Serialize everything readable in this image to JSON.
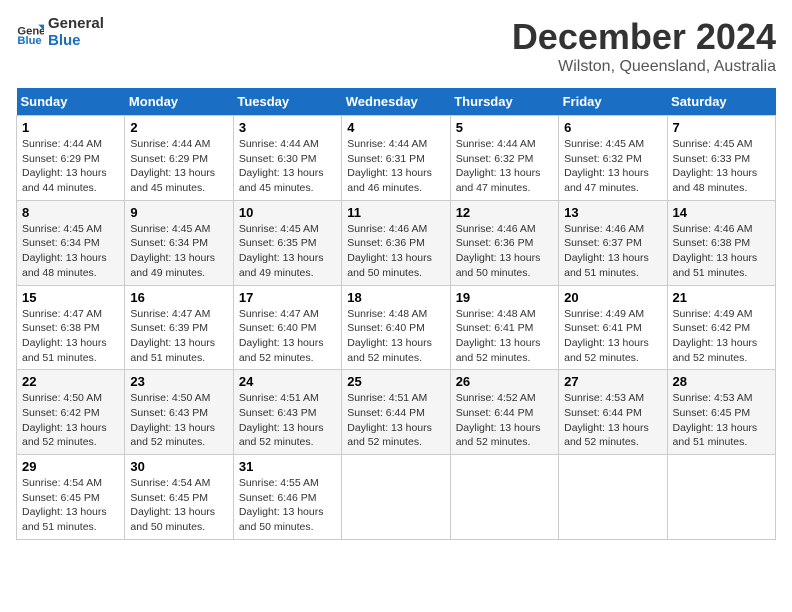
{
  "header": {
    "logo_line1": "General",
    "logo_line2": "Blue",
    "title": "December 2024",
    "subtitle": "Wilston, Queensland, Australia"
  },
  "weekdays": [
    "Sunday",
    "Monday",
    "Tuesday",
    "Wednesday",
    "Thursday",
    "Friday",
    "Saturday"
  ],
  "weeks": [
    [
      {
        "day": 1,
        "sunrise": "4:44 AM",
        "sunset": "6:29 PM",
        "daylight": "13 hours and 44 minutes."
      },
      {
        "day": 2,
        "sunrise": "4:44 AM",
        "sunset": "6:29 PM",
        "daylight": "13 hours and 45 minutes."
      },
      {
        "day": 3,
        "sunrise": "4:44 AM",
        "sunset": "6:30 PM",
        "daylight": "13 hours and 45 minutes."
      },
      {
        "day": 4,
        "sunrise": "4:44 AM",
        "sunset": "6:31 PM",
        "daylight": "13 hours and 46 minutes."
      },
      {
        "day": 5,
        "sunrise": "4:44 AM",
        "sunset": "6:32 PM",
        "daylight": "13 hours and 47 minutes."
      },
      {
        "day": 6,
        "sunrise": "4:45 AM",
        "sunset": "6:32 PM",
        "daylight": "13 hours and 47 minutes."
      },
      {
        "day": 7,
        "sunrise": "4:45 AM",
        "sunset": "6:33 PM",
        "daylight": "13 hours and 48 minutes."
      }
    ],
    [
      {
        "day": 8,
        "sunrise": "4:45 AM",
        "sunset": "6:34 PM",
        "daylight": "13 hours and 48 minutes."
      },
      {
        "day": 9,
        "sunrise": "4:45 AM",
        "sunset": "6:34 PM",
        "daylight": "13 hours and 49 minutes."
      },
      {
        "day": 10,
        "sunrise": "4:45 AM",
        "sunset": "6:35 PM",
        "daylight": "13 hours and 49 minutes."
      },
      {
        "day": 11,
        "sunrise": "4:46 AM",
        "sunset": "6:36 PM",
        "daylight": "13 hours and 50 minutes."
      },
      {
        "day": 12,
        "sunrise": "4:46 AM",
        "sunset": "6:36 PM",
        "daylight": "13 hours and 50 minutes."
      },
      {
        "day": 13,
        "sunrise": "4:46 AM",
        "sunset": "6:37 PM",
        "daylight": "13 hours and 51 minutes."
      },
      {
        "day": 14,
        "sunrise": "4:46 AM",
        "sunset": "6:38 PM",
        "daylight": "13 hours and 51 minutes."
      }
    ],
    [
      {
        "day": 15,
        "sunrise": "4:47 AM",
        "sunset": "6:38 PM",
        "daylight": "13 hours and 51 minutes."
      },
      {
        "day": 16,
        "sunrise": "4:47 AM",
        "sunset": "6:39 PM",
        "daylight": "13 hours and 51 minutes."
      },
      {
        "day": 17,
        "sunrise": "4:47 AM",
        "sunset": "6:40 PM",
        "daylight": "13 hours and 52 minutes."
      },
      {
        "day": 18,
        "sunrise": "4:48 AM",
        "sunset": "6:40 PM",
        "daylight": "13 hours and 52 minutes."
      },
      {
        "day": 19,
        "sunrise": "4:48 AM",
        "sunset": "6:41 PM",
        "daylight": "13 hours and 52 minutes."
      },
      {
        "day": 20,
        "sunrise": "4:49 AM",
        "sunset": "6:41 PM",
        "daylight": "13 hours and 52 minutes."
      },
      {
        "day": 21,
        "sunrise": "4:49 AM",
        "sunset": "6:42 PM",
        "daylight": "13 hours and 52 minutes."
      }
    ],
    [
      {
        "day": 22,
        "sunrise": "4:50 AM",
        "sunset": "6:42 PM",
        "daylight": "13 hours and 52 minutes."
      },
      {
        "day": 23,
        "sunrise": "4:50 AM",
        "sunset": "6:43 PM",
        "daylight": "13 hours and 52 minutes."
      },
      {
        "day": 24,
        "sunrise": "4:51 AM",
        "sunset": "6:43 PM",
        "daylight": "13 hours and 52 minutes."
      },
      {
        "day": 25,
        "sunrise": "4:51 AM",
        "sunset": "6:44 PM",
        "daylight": "13 hours and 52 minutes."
      },
      {
        "day": 26,
        "sunrise": "4:52 AM",
        "sunset": "6:44 PM",
        "daylight": "13 hours and 52 minutes."
      },
      {
        "day": 27,
        "sunrise": "4:53 AM",
        "sunset": "6:44 PM",
        "daylight": "13 hours and 52 minutes."
      },
      {
        "day": 28,
        "sunrise": "4:53 AM",
        "sunset": "6:45 PM",
        "daylight": "13 hours and 51 minutes."
      }
    ],
    [
      {
        "day": 29,
        "sunrise": "4:54 AM",
        "sunset": "6:45 PM",
        "daylight": "13 hours and 51 minutes."
      },
      {
        "day": 30,
        "sunrise": "4:54 AM",
        "sunset": "6:45 PM",
        "daylight": "13 hours and 50 minutes."
      },
      {
        "day": 31,
        "sunrise": "4:55 AM",
        "sunset": "6:46 PM",
        "daylight": "13 hours and 50 minutes."
      },
      null,
      null,
      null,
      null
    ]
  ]
}
